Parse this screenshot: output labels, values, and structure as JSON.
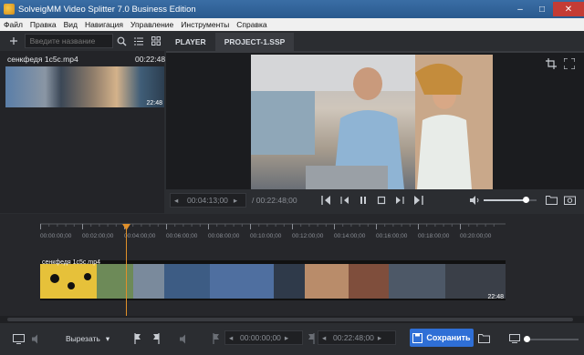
{
  "window": {
    "title": "SolveigMM Video Splitter 7.0 Business Edition",
    "minimize": "–",
    "maximize": "□",
    "close": "✕"
  },
  "menu": [
    "Файл",
    "Правка",
    "Вид",
    "Навигация",
    "Управление",
    "Инструменты",
    "Справка"
  ],
  "library": {
    "add_icon": "plus-icon",
    "search_placeholder": "Введите название",
    "file": {
      "name": "сенкфедя 1с5с.mp4",
      "duration": "00:22:48",
      "thumb_time": "22:48"
    }
  },
  "tabs": [
    {
      "label": "PLAYER"
    },
    {
      "label": "PROJECT-1.SSP"
    }
  ],
  "player": {
    "current_time": "00:04:13;00",
    "total_time": "/ 00:22:48;00",
    "volume_level": 0.8
  },
  "timeline": {
    "ticks": [
      "00:00:00;00",
      "00:02:00;00",
      "00:04:00;00",
      "00:06:00;00",
      "00:08:00;00",
      "00:10:00;00",
      "00:12:00;00",
      "00:14:00;00",
      "00:16:00;00",
      "00:18:00;00",
      "00:20:00;00"
    ],
    "clip_label": "сенкфедя 1с5с.mp4",
    "clip_end": "22:48",
    "playhead_time": "00:04:13;00"
  },
  "bottom": {
    "cut_label": "Вырезать",
    "in_time": "00:00:00;00",
    "out_time": "00:22:48;00",
    "save_label": "Сохранить"
  },
  "colors": {
    "accent": "#2f6fd6",
    "playhead": "#e0902a",
    "title_bar": "#2a5a8e"
  }
}
